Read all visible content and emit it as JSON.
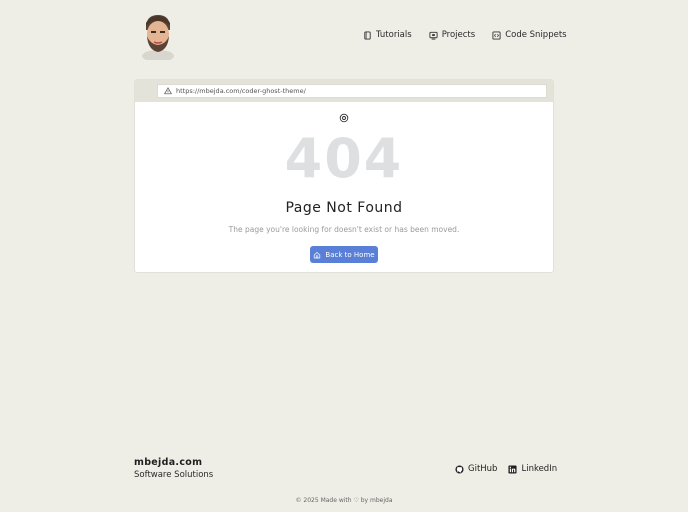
{
  "header": {
    "nav": [
      {
        "label": "Tutorials",
        "icon": "document-icon"
      },
      {
        "label": "Projects",
        "icon": "monitor-icon"
      },
      {
        "label": "Code Snippets",
        "icon": "code-icon"
      }
    ]
  },
  "browser": {
    "url": "https://mbejda.com/coder-ghost-theme/"
  },
  "error": {
    "code": "404",
    "title": "Page Not Found",
    "message": "The page you're looking for doesn't exist or has been moved.",
    "button_label": "Back to Home"
  },
  "footer": {
    "brand_name": "mbejda.com",
    "tagline": "Software Solutions",
    "links": [
      {
        "label": "GitHub",
        "icon": "github-icon"
      },
      {
        "label": "LinkedIn",
        "icon": "linkedin-icon"
      }
    ],
    "copyright": "© 2025 Made with ♡ by mbejda"
  },
  "colors": {
    "background": "#eeede6",
    "accent": "#5a7fd6",
    "code_color": "#dedfe1"
  }
}
